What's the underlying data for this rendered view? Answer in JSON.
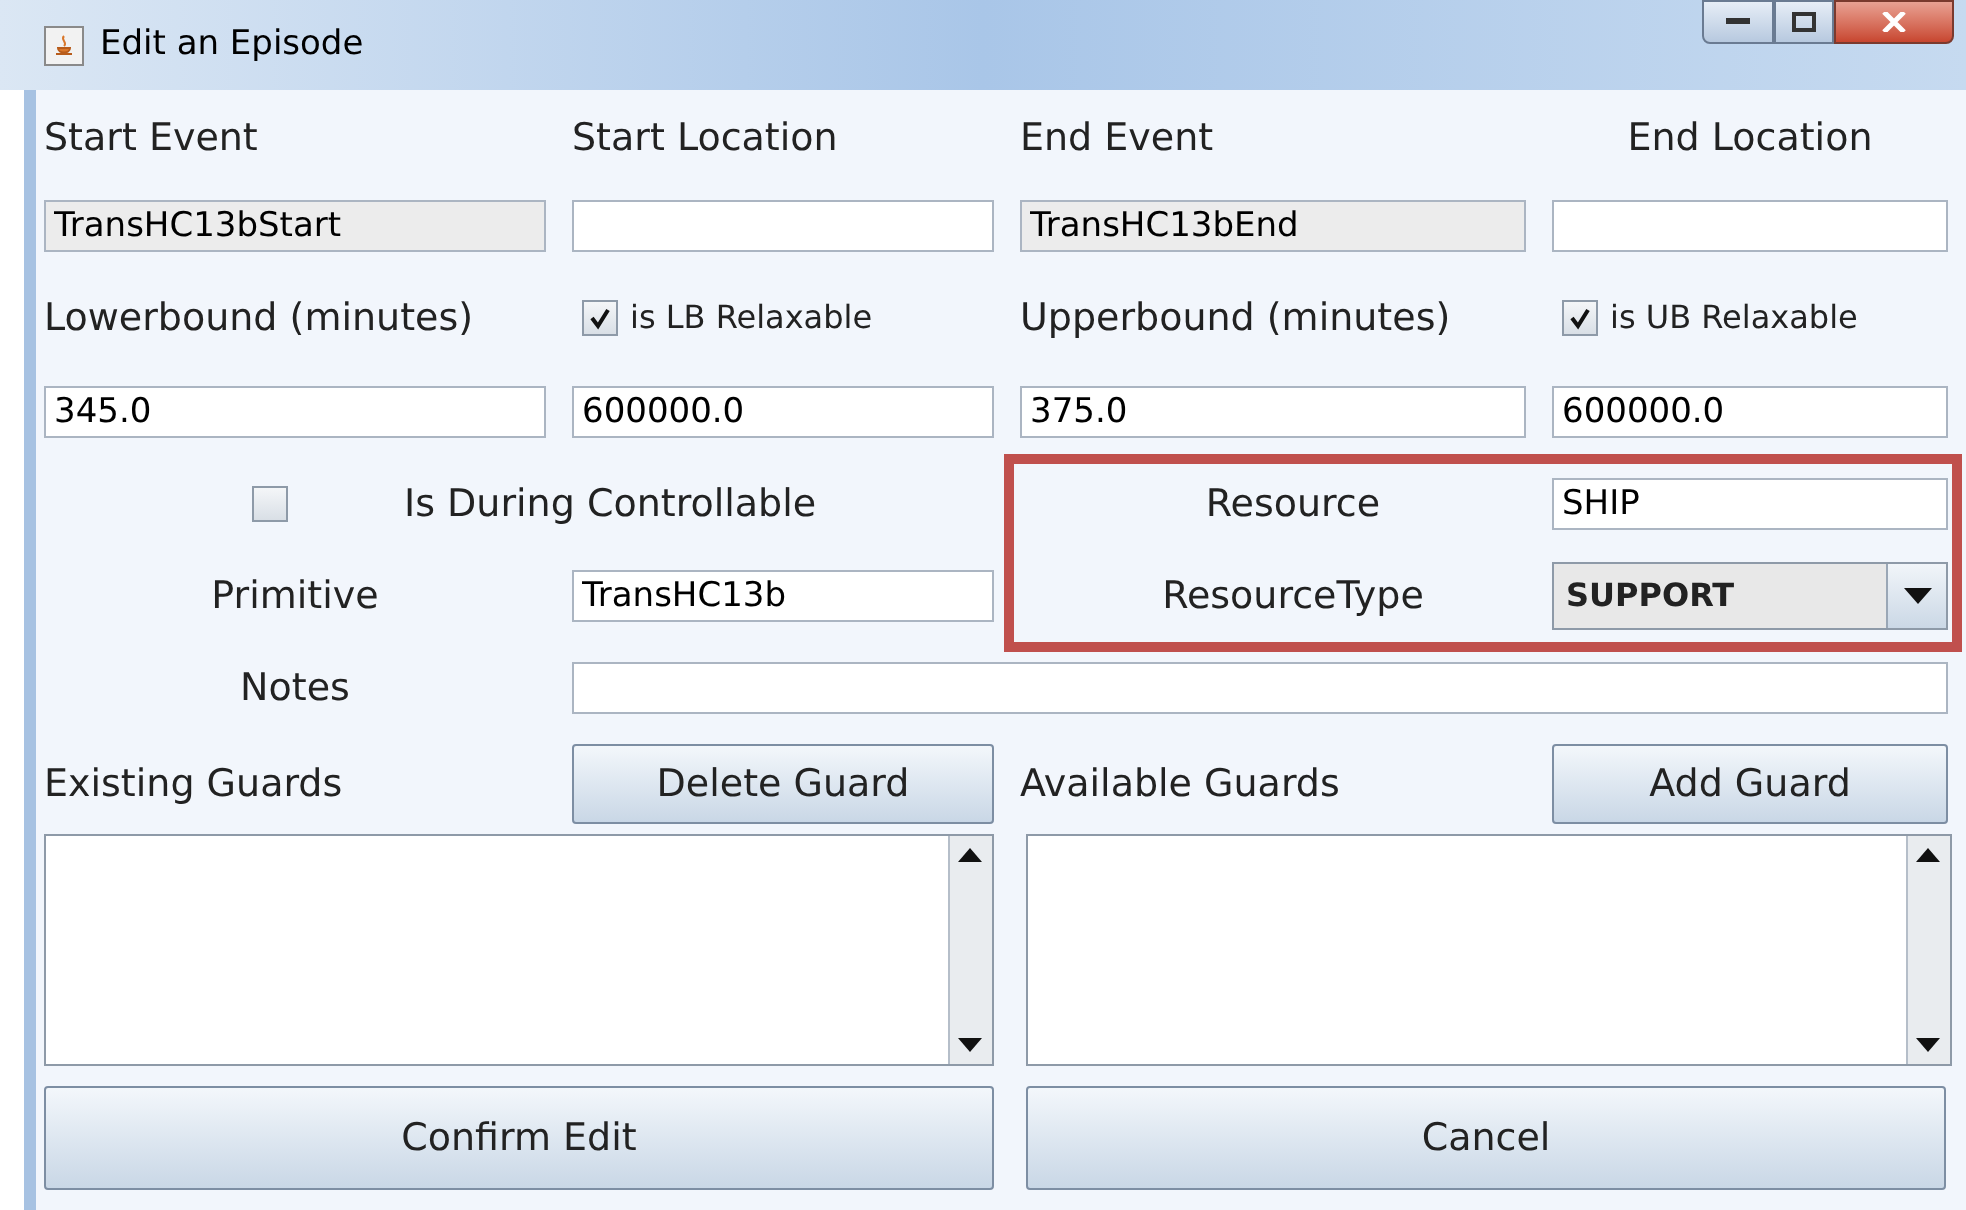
{
  "window": {
    "title": "Edit an Episode"
  },
  "header_labels": [
    "Start Event",
    "Start Location",
    "End Event",
    "End Location"
  ],
  "event_fields": [
    {
      "value": "TransHC13bStart",
      "disabled": true
    },
    {
      "disabled": false
    },
    {
      "value": "TransHC13bEnd",
      "disabled": true
    },
    {
      "disabled": false
    }
  ],
  "bounds": [
    {
      "label": "Lowerbound (minutes)",
      "relax_label": "is LB Relaxable",
      "checked": true,
      "value": "345.0",
      "relax_value": "600000.0"
    },
    {
      "label": "Upperbound (minutes)",
      "relax_label": "is UB Relaxable",
      "checked": true,
      "value": "375.0",
      "relax_value": "600000.0"
    }
  ],
  "during_controllable": {
    "label": "Is During Controllable",
    "checked": false
  },
  "primitive": {
    "label": "Primitive",
    "value": "TransHC13b"
  },
  "resource": {
    "label": "Resource",
    "value": "SHIP"
  },
  "resource_type": {
    "label": "ResourceType",
    "value": "SUPPORT"
  },
  "notes": {
    "label": "Notes"
  },
  "guards": [
    {
      "label": "Existing Guards",
      "button": "Delete Guard"
    },
    {
      "label": "Available Guards",
      "button": "Add Guard"
    }
  ],
  "buttons": [
    "Confirm Edit",
    "Cancel"
  ]
}
